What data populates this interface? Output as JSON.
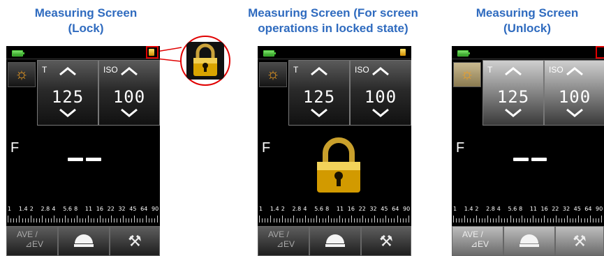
{
  "captions": {
    "left": {
      "line1": "Measuring Screen",
      "line2": "(Lock)"
    },
    "middle": {
      "line1": "Measuring Screen (For screen",
      "line2": "operations in locked state)"
    },
    "right": {
      "line1": "Measuring Screen",
      "line2": "(Unlock)"
    }
  },
  "screen": {
    "param_t_label": "T",
    "param_t_value": "125",
    "param_iso_label": "ISO",
    "param_iso_value": "100",
    "f_label": "F",
    "scale": [
      "1",
      "1.4",
      "2",
      "2.8",
      "4",
      "5.6",
      "8",
      "11",
      "16",
      "22",
      "32",
      "45",
      "64",
      "90"
    ],
    "ave_label": "AVE /",
    "ave_sub": "⊿EV",
    "wrench_glyph": "⚒"
  },
  "colors": {
    "caption": "#2f6bbf",
    "lock_gold": "#d9a400",
    "highlight_red": "#e00000",
    "sun": "#f3a020",
    "battery": "#49c23a"
  },
  "icons": [
    "battery-icon",
    "lock-icon",
    "sun-icon",
    "chevron-up-icon",
    "chevron-down-icon",
    "dome-icon",
    "wrench-icon"
  ]
}
